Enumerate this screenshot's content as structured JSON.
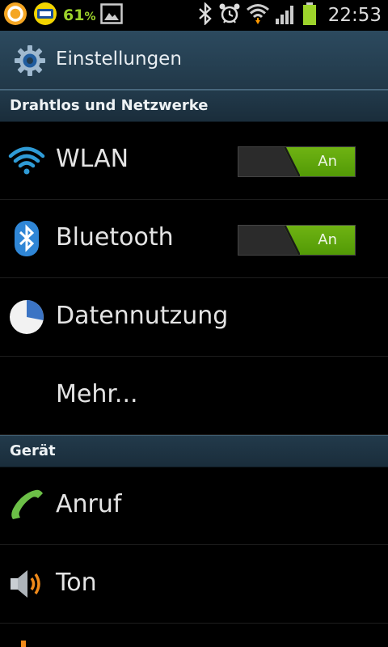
{
  "status_bar": {
    "battery_percent_value": "61",
    "battery_percent_symbol": "%",
    "time": "22:53",
    "icons": [
      "orange-app-icon",
      "app-notification-icon",
      "image-icon",
      "bluetooth-icon",
      "alarm-icon",
      "wifi-icon",
      "signal-icon",
      "battery-icon"
    ],
    "battery_color": "#9dd32b"
  },
  "action_bar": {
    "title": "Einstellungen",
    "icon": "settings-gear-icon"
  },
  "sections": [
    {
      "title": "Drahtlos und Netzwerke",
      "items": [
        {
          "label": "WLAN",
          "icon": "wifi-icon",
          "toggle": "An"
        },
        {
          "label": "Bluetooth",
          "icon": "bluetooth-icon",
          "toggle": "An"
        },
        {
          "label": "Datennutzung",
          "icon": "data-usage-icon"
        },
        {
          "label": "Mehr..."
        }
      ]
    },
    {
      "title": "Gerät",
      "items": [
        {
          "label": "Anruf",
          "icon": "phone-icon"
        },
        {
          "label": "Ton",
          "icon": "speaker-icon"
        }
      ]
    }
  ],
  "colors": {
    "toggle_on": "#5ea80b",
    "header_bg": "#213848",
    "accent_blue": "#2f9bd6"
  }
}
